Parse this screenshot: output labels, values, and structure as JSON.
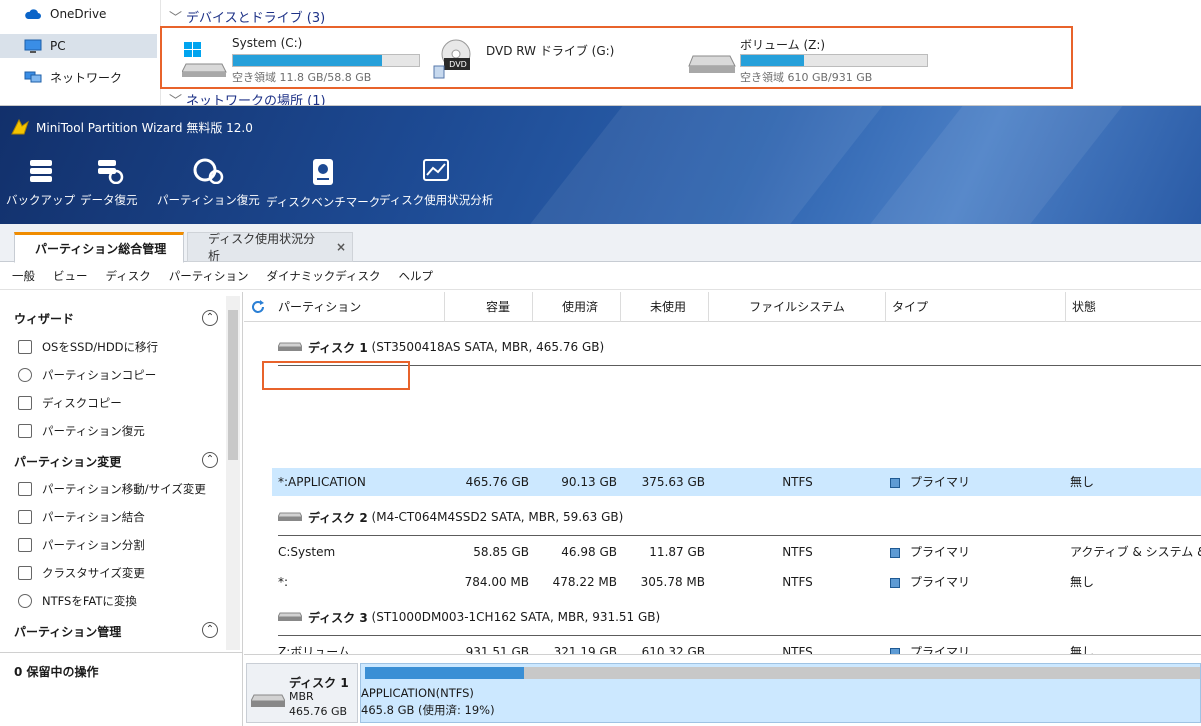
{
  "explorer": {
    "nav": [
      {
        "label": "OneDrive",
        "icon": "cloud-icon"
      },
      {
        "label": "PC",
        "icon": "computer-icon",
        "selected": true
      },
      {
        "label": "ネットワーク",
        "icon": "network-icon"
      }
    ],
    "group_devices": "デバイスとドライブ (3)",
    "group_network": "ネットワークの場所 (1)",
    "drives": [
      {
        "name": "System (C:)",
        "free": "空き領域 11.8 GB/58.8 GB",
        "used_fraction": 0.8
      },
      {
        "name": "DVD RW ドライブ (G:)",
        "badge": "DVD"
      },
      {
        "name": "ボリューム (Z:)",
        "free": "空き領域 610 GB/931 GB",
        "used_fraction": 0.34
      }
    ]
  },
  "app": {
    "title": "MiniTool Partition Wizard 無料版 12.0",
    "toolbar": [
      "バックアップ",
      "データ復元",
      "パーティション復元",
      "ディスクベンチマーク",
      "ディスク使用状況分析"
    ],
    "tabs": [
      {
        "label": "パーティション総合管理",
        "active": true
      },
      {
        "label": "ディスク使用状況分析",
        "close": "×"
      }
    ],
    "menu": [
      "一般",
      "ビュー",
      "ディスク",
      "パーティション",
      "ダイナミックディスク",
      "ヘルプ"
    ]
  },
  "sidebar": {
    "sections": [
      {
        "title": "ウィザード",
        "toggle": "⌃",
        "items": [
          "OSをSSD/HDDに移行",
          "パーティションコピー",
          "ディスクコピー",
          "パーティション復元"
        ]
      },
      {
        "title": "パーティション変更",
        "toggle": "⌃",
        "items": [
          "パーティション移動/サイズ変更",
          "パーティション結合",
          "パーティション分割",
          "クラスタサイズ変更",
          "NTFSをFATに変換"
        ]
      },
      {
        "title": "パーティション管理",
        "toggle": "⌃",
        "items": []
      }
    ],
    "pending": "0 保留中の操作"
  },
  "table": {
    "headers": [
      "パーティション",
      "容量",
      "使用済",
      "未使用",
      "ファイルシステム",
      "タイプ",
      "状態"
    ],
    "disks": [
      {
        "name": "ディスク 1",
        "detail": "(ST3500418AS SATA, MBR, 465.76 GB)",
        "partitions": [
          {
            "name": "*:APPLICATION",
            "cap": "465.76 GB",
            "used": "90.13 GB",
            "unused": "375.63 GB",
            "fs": "NTFS",
            "type": "プライマリ",
            "status": "無し",
            "selected": true
          }
        ]
      },
      {
        "name": "ディスク 2",
        "detail": "(M4-CT064M4SSD2 SATA, MBR, 59.63 GB)",
        "partitions": [
          {
            "name": "C:System",
            "cap": "58.85 GB",
            "used": "46.98 GB",
            "unused": "11.87 GB",
            "fs": "NTFS",
            "type": "プライマリ",
            "status": "アクティブ & システム & ブート"
          },
          {
            "name": "*:",
            "cap": "784.00 MB",
            "used": "478.22 MB",
            "unused": "305.78 MB",
            "fs": "NTFS",
            "type": "プライマリ",
            "status": "無し"
          }
        ]
      },
      {
        "name": "ディスク 3",
        "detail": "(ST1000DM003-1CH162 SATA, MBR, 931.51 GB)",
        "partitions": [
          {
            "name": "Z:ボリューム",
            "cap": "931.51 GB",
            "used": "321.19 GB",
            "unused": "610.32 GB",
            "fs": "NTFS",
            "type": "プライマリ",
            "status": "無し"
          }
        ]
      }
    ]
  },
  "diskmap": {
    "disk_name": "ディスク 1",
    "disk_type": "MBR",
    "disk_size": "465.76 GB",
    "part_label": "APPLICATION(NTFS)",
    "part_detail": "465.8 GB (使用済: 19%)",
    "used_fraction": 0.19
  },
  "colors": {
    "accent": "#26a0da",
    "highlight": "#e8632b",
    "selection": "#cce8ff"
  }
}
